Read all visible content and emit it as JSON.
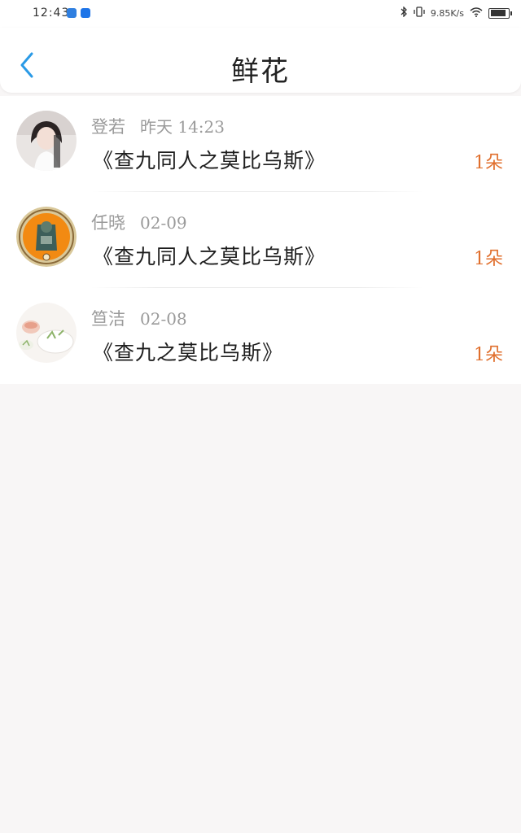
{
  "status_bar": {
    "time": "12:43",
    "net_speed": "9.85K/s",
    "battery_level": 0.85
  },
  "header": {
    "title": "鲜花"
  },
  "items": [
    {
      "name": "登若",
      "time": "昨天 14:23",
      "book": "《查九同人之莫比乌斯》",
      "count": "1朵"
    },
    {
      "name": "任晓",
      "time": "02-09",
      "book": "《查九同人之莫比乌斯》",
      "count": "1朵"
    },
    {
      "name": "笪洁",
      "time": "02-08",
      "book": "《查九之莫比乌斯》",
      "count": "1朵"
    }
  ],
  "colors": {
    "accent": "#2a9ae6",
    "count": "#e06f2d",
    "meta": "#9a9a9a",
    "background": "#f8f6f6"
  }
}
